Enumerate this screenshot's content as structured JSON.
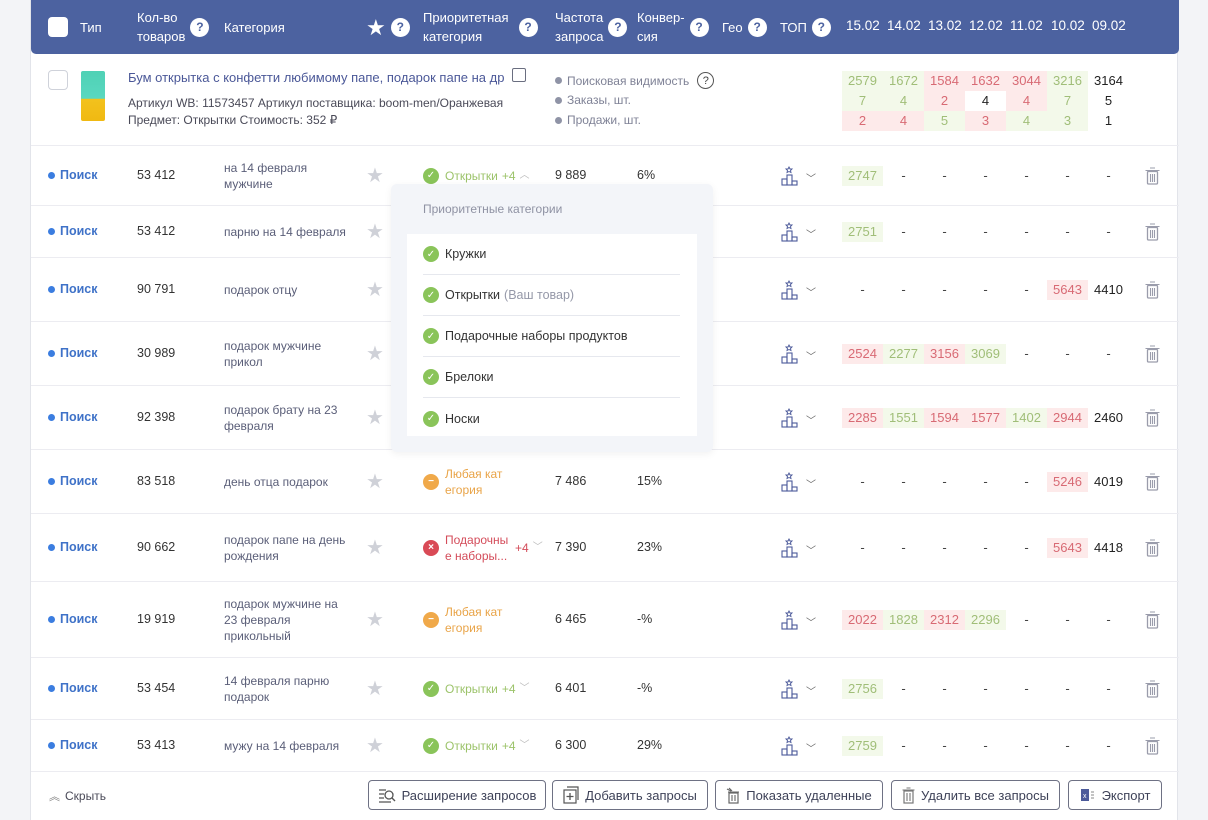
{
  "header": {
    "type": "Тип",
    "count_l1": "Кол-во",
    "count_l2": "товаров",
    "category": "Категория",
    "prio_l1": "Приоритетная",
    "prio_l2": "категория",
    "freq_l1": "Частота",
    "freq_l2": "запроса",
    "conv_l1": "Конвер-",
    "conv_l2": "сия",
    "geo": "Гео",
    "top": "ТОП",
    "help": "?",
    "dates": [
      "15.02",
      "14.02",
      "13.02",
      "12.02",
      "11.02",
      "10.02",
      "09.02"
    ]
  },
  "product": {
    "title": "Бум открытка с конфетти любимому папе, подарок папе на др",
    "meta1": "Артикул WB: 11573457  Артикул поставщика: boom-men/Оранжевая",
    "meta2": "Предмет: Открытки  Стоимость: 352 ₽",
    "legend": [
      "Поисковая видимость",
      "Заказы, шт.",
      "Продажи, шт."
    ],
    "legend_help": "?",
    "grid": [
      [
        {
          "v": "2579",
          "c": "g"
        },
        {
          "v": "1672",
          "c": "g"
        },
        {
          "v": "1584",
          "c": "r"
        },
        {
          "v": "1632",
          "c": "r"
        },
        {
          "v": "3044",
          "c": "r"
        },
        {
          "v": "3216",
          "c": "g"
        },
        {
          "v": "3164",
          "c": "n"
        }
      ],
      [
        {
          "v": "7",
          "c": "g"
        },
        {
          "v": "4",
          "c": "g"
        },
        {
          "v": "2",
          "c": "r"
        },
        {
          "v": "4",
          "c": "n"
        },
        {
          "v": "4",
          "c": "r"
        },
        {
          "v": "7",
          "c": "g"
        },
        {
          "v": "5",
          "c": "n"
        }
      ],
      [
        {
          "v": "2",
          "c": "r"
        },
        {
          "v": "4",
          "c": "r"
        },
        {
          "v": "5",
          "c": "g"
        },
        {
          "v": "3",
          "c": "r"
        },
        {
          "v": "4",
          "c": "g"
        },
        {
          "v": "3",
          "c": "g"
        },
        {
          "v": "1",
          "c": "n"
        }
      ]
    ]
  },
  "rows": [
    {
      "type": "Поиск",
      "count": "53 412",
      "kw": "на 14 февраля мужчине",
      "prio": "Открытки",
      "prio_extra": "+4",
      "prio_state": "ok",
      "chev": "up",
      "freq": "9 889",
      "conv": "6%",
      "days": [
        {
          "v": "2747",
          "c": "g"
        },
        {
          "v": "-"
        },
        {
          "v": "-"
        },
        {
          "v": "-"
        },
        {
          "v": "-"
        },
        {
          "v": "-"
        },
        {
          "v": "-"
        }
      ]
    },
    {
      "type": "Поиск",
      "count": "53 412",
      "kw": "парню на 14 февраля",
      "prio": "",
      "prio_extra": "",
      "prio_state": "hidden",
      "chev": "",
      "freq": "",
      "conv": "",
      "days": [
        {
          "v": "2751",
          "c": "g"
        },
        {
          "v": "-"
        },
        {
          "v": "-"
        },
        {
          "v": "-"
        },
        {
          "v": "-"
        },
        {
          "v": "-"
        },
        {
          "v": "-"
        }
      ]
    },
    {
      "type": "Поиск",
      "count": "90 791",
      "kw": "подарок отцу",
      "prio": "",
      "prio_extra": "",
      "prio_state": "hidden",
      "chev": "",
      "freq": "",
      "conv": "",
      "days": [
        {
          "v": "-"
        },
        {
          "v": "-"
        },
        {
          "v": "-"
        },
        {
          "v": "-"
        },
        {
          "v": "-"
        },
        {
          "v": "5643",
          "c": "r"
        },
        {
          "v": "4410",
          "c": "n"
        }
      ]
    },
    {
      "type": "Поиск",
      "count": "30 989",
      "kw": "подарок мужчине прикол",
      "prio": "",
      "prio_extra": "",
      "prio_state": "hidden",
      "chev": "",
      "freq": "",
      "conv": "",
      "days": [
        {
          "v": "2524",
          "c": "r"
        },
        {
          "v": "2277",
          "c": "g"
        },
        {
          "v": "3156",
          "c": "r"
        },
        {
          "v": "3069",
          "c": "g"
        },
        {
          "v": "-"
        },
        {
          "v": "-"
        },
        {
          "v": "-"
        }
      ]
    },
    {
      "type": "Поиск",
      "count": "92 398",
      "kw": "подарок брату на 23 февраля",
      "prio": "",
      "prio_extra": "",
      "prio_state": "hidden",
      "chev": "",
      "freq": "",
      "conv": "",
      "days": [
        {
          "v": "2285",
          "c": "r"
        },
        {
          "v": "1551",
          "c": "g"
        },
        {
          "v": "1594",
          "c": "r"
        },
        {
          "v": "1577",
          "c": "r"
        },
        {
          "v": "1402",
          "c": "g"
        },
        {
          "v": "2944",
          "c": "r"
        },
        {
          "v": "2460",
          "c": "n"
        }
      ]
    },
    {
      "type": "Поиск",
      "count": "83 518",
      "kw": "день отца подарок",
      "prio": "Любая категория",
      "prio_extra": "",
      "prio_state": "any",
      "chev": "",
      "freq": "7 486",
      "conv": "15%",
      "days": [
        {
          "v": "-"
        },
        {
          "v": "-"
        },
        {
          "v": "-"
        },
        {
          "v": "-"
        },
        {
          "v": "-"
        },
        {
          "v": "5246",
          "c": "r"
        },
        {
          "v": "4019",
          "c": "n"
        }
      ]
    },
    {
      "type": "Поиск",
      "count": "90 662",
      "kw": "подарок папе на день рождения",
      "prio": "Подарочные наборы...",
      "prio_extra": "+4",
      "prio_state": "bad",
      "chev": "down",
      "freq": "7 390",
      "conv": "23%",
      "days": [
        {
          "v": "-"
        },
        {
          "v": "-"
        },
        {
          "v": "-"
        },
        {
          "v": "-"
        },
        {
          "v": "-"
        },
        {
          "v": "5643",
          "c": "r"
        },
        {
          "v": "4418",
          "c": "n"
        }
      ]
    },
    {
      "type": "Поиск",
      "count": "19 919",
      "kw": "подарок мужчине на 23 февраля прикольный",
      "prio": "Любая категория",
      "prio_extra": "",
      "prio_state": "any",
      "chev": "",
      "freq": "6 465",
      "conv": "-%",
      "days": [
        {
          "v": "2022",
          "c": "r"
        },
        {
          "v": "1828",
          "c": "g"
        },
        {
          "v": "2312",
          "c": "r"
        },
        {
          "v": "2296",
          "c": "g"
        },
        {
          "v": "-"
        },
        {
          "v": "-"
        },
        {
          "v": "-"
        }
      ]
    },
    {
      "type": "Поиск",
      "count": "53 454",
      "kw": "14 февраля парню подарок",
      "prio": "Открытки",
      "prio_extra": "+4",
      "prio_state": "ok",
      "chev": "down",
      "freq": "6 401",
      "conv": "-%",
      "days": [
        {
          "v": "2756",
          "c": "g"
        },
        {
          "v": "-"
        },
        {
          "v": "-"
        },
        {
          "v": "-"
        },
        {
          "v": "-"
        },
        {
          "v": "-"
        },
        {
          "v": "-"
        }
      ]
    },
    {
      "type": "Поиск",
      "count": "53 413",
      "kw": "мужу на 14 февраля",
      "prio": "Открытки",
      "prio_extra": "+4",
      "prio_state": "ok",
      "chev": "down",
      "freq": "6 300",
      "conv": "29%",
      "days": [
        {
          "v": "2759",
          "c": "g"
        },
        {
          "v": "-"
        },
        {
          "v": "-"
        },
        {
          "v": "-"
        },
        {
          "v": "-"
        },
        {
          "v": "-"
        },
        {
          "v": "-"
        }
      ]
    }
  ],
  "popup": {
    "title": "Приоритетные категории",
    "items": [
      {
        "label": "Кружки",
        "tag": ""
      },
      {
        "label": "Открытки",
        "tag": "(Ваш товар)"
      },
      {
        "label": "Подарочные наборы продуктов",
        "tag": ""
      },
      {
        "label": "Брелоки",
        "tag": ""
      },
      {
        "label": "Носки",
        "tag": ""
      }
    ]
  },
  "footer": {
    "hide": "Скрыть",
    "expand": "Расширение запросов",
    "add": "Добавить запросы",
    "show_deleted": "Показать удаленные",
    "delete_all": "Удалить все запросы",
    "export": "Экспорт"
  },
  "colors": {
    "header_bg": "#4c62a0",
    "green_text": "#a0be78",
    "red_text": "#d86a74",
    "link_blue": "#3f72c8"
  }
}
